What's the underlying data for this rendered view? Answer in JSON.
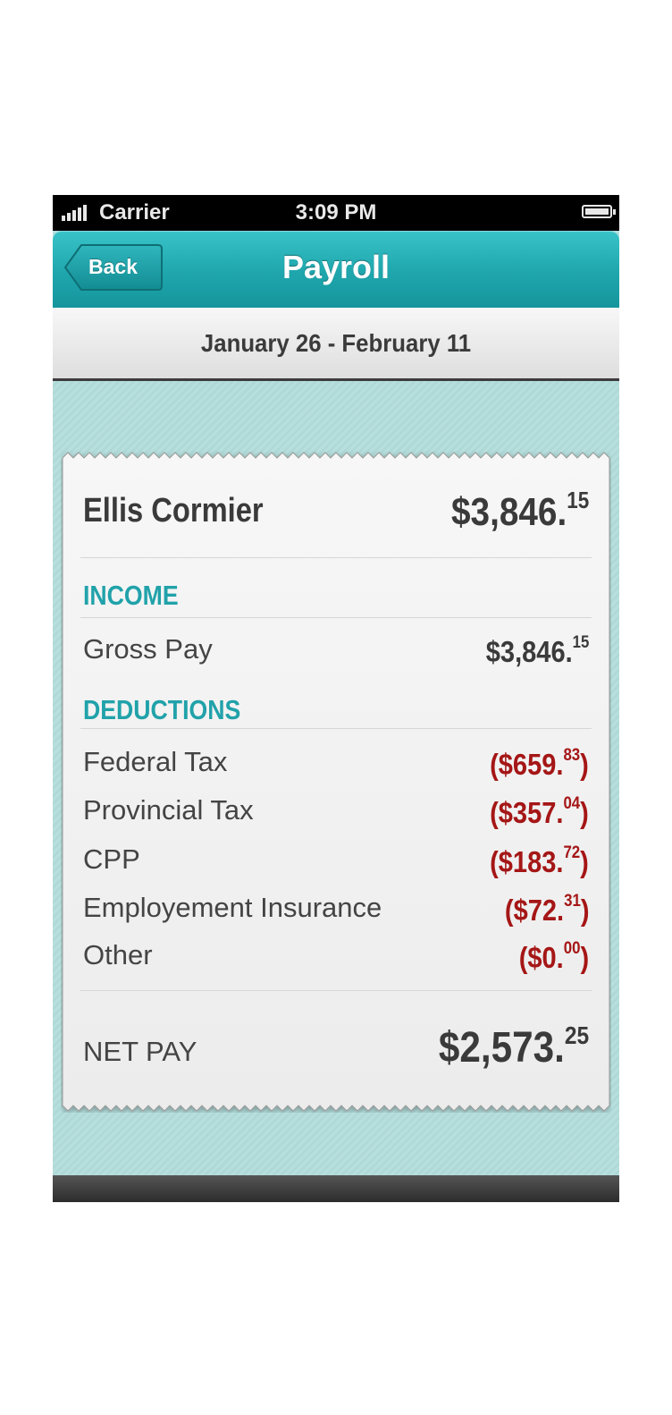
{
  "status_bar": {
    "carrier": "Carrier",
    "time": "3:09 PM"
  },
  "nav": {
    "back_label": "Back",
    "title": "Payroll"
  },
  "period": "January 26 - February 11",
  "employee": {
    "name": "Ellis Cormier",
    "amount_main": "$3,846.",
    "amount_cents": "15"
  },
  "income": {
    "heading": "INCOME",
    "items": [
      {
        "label": "Gross Pay",
        "amount_main": "$3,846.",
        "amount_cents": "15"
      }
    ]
  },
  "deductions": {
    "heading": "DEDUCTIONS",
    "items": [
      {
        "label": "Federal Tax",
        "amount_main": "($659.",
        "amount_cents": "83",
        "close": ")"
      },
      {
        "label": "Provincial Tax",
        "amount_main": "($357.",
        "amount_cents": "04",
        "close": ")"
      },
      {
        "label": "CPP",
        "amount_main": "($183.",
        "amount_cents": "72",
        "close": ")"
      },
      {
        "label": "Employement Insurance",
        "amount_main": "($72.",
        "amount_cents": "31",
        "close": ")"
      },
      {
        "label": "Other",
        "amount_main": "($0.",
        "amount_cents": "00",
        "close": ")"
      }
    ]
  },
  "net_pay": {
    "label": "NET PAY",
    "amount_main": "$2,573.",
    "amount_cents": "25"
  },
  "colors": {
    "accent": "#21a2aa",
    "negative": "#a51616",
    "background": "#b5dedd"
  }
}
